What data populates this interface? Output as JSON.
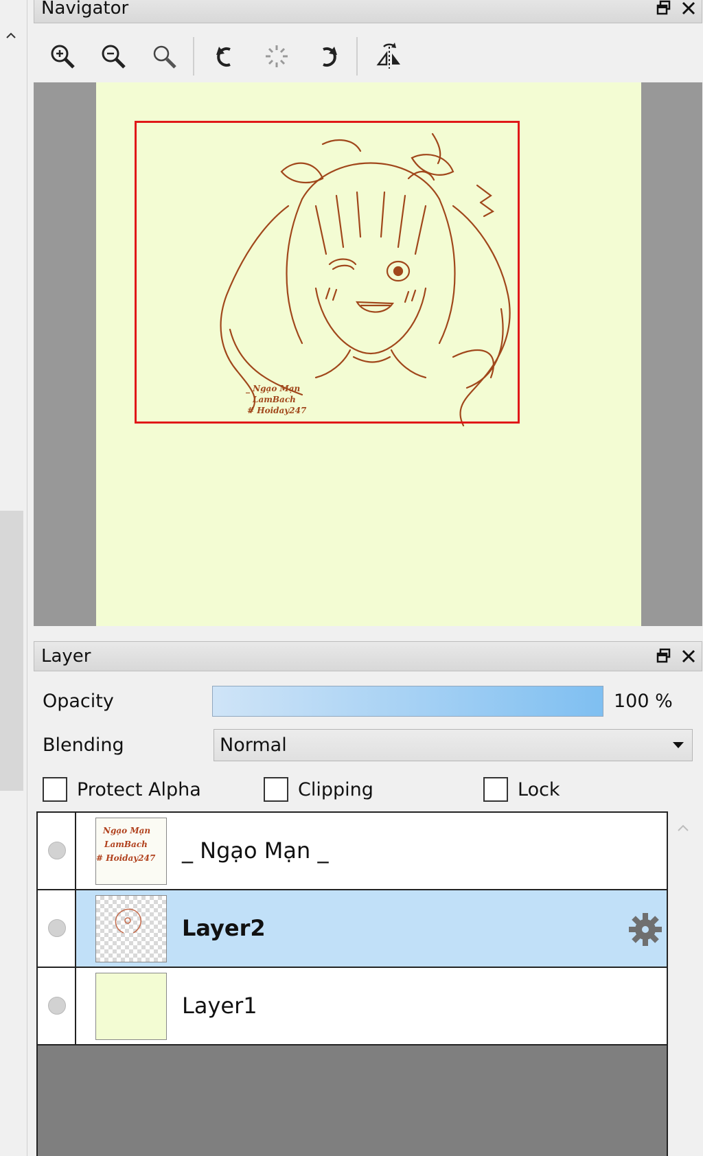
{
  "navigator": {
    "title": "Navigator",
    "toolbar": [
      {
        "icon": "zoom-in-icon"
      },
      {
        "icon": "zoom-out-icon"
      },
      {
        "icon": "zoom-reset-icon"
      },
      {
        "icon": "rotate-left-icon"
      },
      {
        "icon": "rotate-reset-icon"
      },
      {
        "icon": "rotate-right-icon"
      },
      {
        "icon": "flip-horizontal-icon"
      }
    ],
    "artwork_signature": [
      "_ Ngạo Mạn",
      "LamBach",
      "# Hoiday247"
    ],
    "canvas_color": "#f3fcd3",
    "viewport_color": "#e01818",
    "line_art_color": "#a0471b"
  },
  "layer_panel": {
    "title": "Layer",
    "opacity_label": "Opacity",
    "opacity_value": "100 %",
    "opacity_level": 1.0,
    "blending_label": "Blending",
    "blending_value": "Normal",
    "checkboxes": {
      "protect_alpha": {
        "label": "Protect Alpha",
        "checked": false
      },
      "clipping": {
        "label": "Clipping",
        "checked": false
      },
      "lock": {
        "label": "Lock",
        "checked": false
      }
    },
    "layers": [
      {
        "name": "_ Ngạo Mạn _",
        "selected": false,
        "thumb_text": [
          "Ngạo Mạn",
          "LamBach",
          "# Hoiday247"
        ]
      },
      {
        "name": "Layer2",
        "selected": true
      },
      {
        "name": "Layer1",
        "selected": false
      }
    ]
  }
}
